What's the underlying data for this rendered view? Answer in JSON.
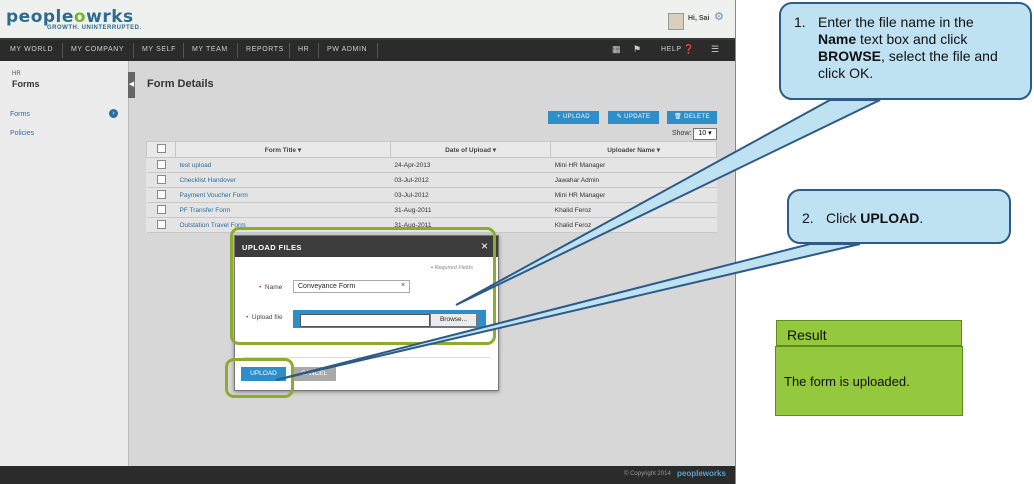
{
  "header": {
    "logo_pre": "pe",
    "logo_mid": "ple",
    "logo_post": "wrks",
    "tagline": "GROWTH. UNINTERRUPTED.",
    "greeting": "Hi, Sai",
    "icons": [
      "avatar",
      "gear-icon"
    ]
  },
  "nav": {
    "items": [
      "MY WORLD",
      "MY COMPANY",
      "MY SELF",
      "MY TEAM",
      "REPORTS",
      "HR",
      "PW ADMIN"
    ],
    "help": "HELP",
    "icons": [
      "grid-icon",
      "flag-icon",
      "help-icon",
      "menu-icon"
    ]
  },
  "sidebar": {
    "section": "HR",
    "title": "Forms",
    "items": [
      {
        "label": "Forms",
        "active": true
      },
      {
        "label": "Policies",
        "active": false
      }
    ]
  },
  "main": {
    "title": "Form Details",
    "buttons": {
      "upload": "+ UPLOAD",
      "update": "✎ UPDATE",
      "delete": "🗑 DELETE"
    },
    "show_label": "Show:",
    "show_value": "10",
    "columns": [
      "Form Title ▾",
      "Date of Upload ▾",
      "Uploader Name ▾"
    ],
    "rows": [
      {
        "title": "test upload",
        "date": "24-Apr-2013",
        "uploader": "Mini HR Manager"
      },
      {
        "title": "Checklist Handover",
        "date": "03-Jul-2012",
        "uploader": "Jawahar Admin"
      },
      {
        "title": "Payment Voucher Form",
        "date": "03-Jul-2012",
        "uploader": "Mini HR Manager"
      },
      {
        "title": "PF Transfer Form",
        "date": "31-Aug-2011",
        "uploader": "Khalid Feroz"
      },
      {
        "title": "Outstation Travel Form",
        "date": "31-Aug-2011",
        "uploader": "Khalid Feroz"
      }
    ]
  },
  "modal": {
    "title": "UPLOAD FILES",
    "close": "×",
    "required_note": "Required Fields",
    "name_label": "Name",
    "name_value": "Conveyance Form",
    "clear": "×",
    "file_label": "Upload file",
    "browse": "Browse...",
    "upload": "UPLOAD",
    "cancel": "CANCEL"
  },
  "footer": {
    "copyright": "© Copyright 2014",
    "logo": "peopleworks"
  },
  "callouts": {
    "step1": {
      "num": "1.",
      "pre": "Enter the file name in the ",
      "bold1": "Name",
      "mid": " text box and click ",
      "bold2": "BROWSE",
      "post": ", select the file and click OK."
    },
    "step2": {
      "num": "2.",
      "pre": "Click ",
      "bold": "UPLOAD",
      "post": "."
    },
    "result_title": "Result",
    "result_text": "The form is uploaded."
  },
  "colors": {
    "accent": "#2e8ec9",
    "highlight": "#8dab2c",
    "callout_bg": "#bfe2f3",
    "result_bg": "#93c83f"
  }
}
